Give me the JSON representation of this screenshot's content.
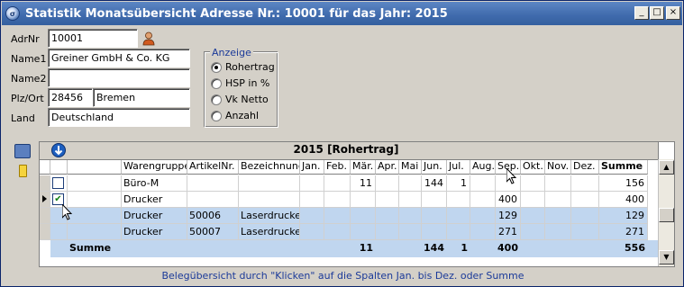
{
  "window": {
    "title": "Statistik Monatsübersicht Adresse Nr.: 10001 für das Jahr: 2015",
    "icon": "app-icon",
    "min": "_",
    "max": "□",
    "close": "×"
  },
  "form": {
    "adrnr_label": "AdrNr",
    "adrnr_value": "10001",
    "name1_label": "Name1",
    "name1_value": "Greiner GmbH & Co. KG",
    "name2_label": "Name2",
    "name2_value": "",
    "plzort_label": "Plz/Ort",
    "plz_value": "28456",
    "ort_value": "Bremen",
    "land_label": "Land",
    "land_value": "Deutschland"
  },
  "anzeige": {
    "legend": "Anzeige",
    "options": [
      {
        "label": "Rohertrag",
        "selected": true
      },
      {
        "label": "HSP in %",
        "selected": false
      },
      {
        "label": "Vk Netto",
        "selected": false
      },
      {
        "label": "Anzahl",
        "selected": false
      }
    ]
  },
  "grid": {
    "title": "2015   [Rohertrag]",
    "columns": [
      "Warengruppe",
      "ArtikelNr.",
      "Bezeichnung",
      "Jan.",
      "Feb.",
      "Mär.",
      "Apr.",
      "Mai",
      "Jun.",
      "Jul.",
      "Aug.",
      "Sep.",
      "Okt.",
      "Nov.",
      "Dez.",
      "Summe"
    ],
    "rows": [
      {
        "check": "",
        "cells": [
          "Büro-M",
          "",
          "",
          "",
          "",
          "11",
          "",
          "",
          "144",
          "1",
          "",
          "",
          "",
          "",
          "",
          "156"
        ],
        "selected": false
      },
      {
        "check": "✔",
        "cells": [
          "Drucker",
          "",
          "",
          "",
          "",
          "",
          "",
          "",
          "",
          "",
          "",
          "400",
          "",
          "",
          "",
          "400"
        ],
        "selected": false
      },
      {
        "check": "",
        "cells": [
          "Drucker",
          "50006",
          "Laserdrucker",
          "",
          "",
          "",
          "",
          "",
          "",
          "",
          "",
          "129",
          "",
          "",
          "",
          "129"
        ],
        "selected": true
      },
      {
        "check": "",
        "cells": [
          "Drucker",
          "50007",
          "Laserdrucker",
          "",
          "",
          "",
          "",
          "",
          "",
          "",
          "",
          "271",
          "",
          "",
          "",
          "271"
        ],
        "selected": true
      }
    ],
    "summary": {
      "label": "Summe",
      "cells": [
        "",
        "",
        "",
        "",
        "",
        "11",
        "",
        "",
        "144",
        "1",
        "",
        "400",
        "",
        "",
        "",
        "556"
      ]
    }
  },
  "footer": "Belegübersicht durch \"Klicken\" auf die Spalten Jan. bis Dez. oder Summe"
}
